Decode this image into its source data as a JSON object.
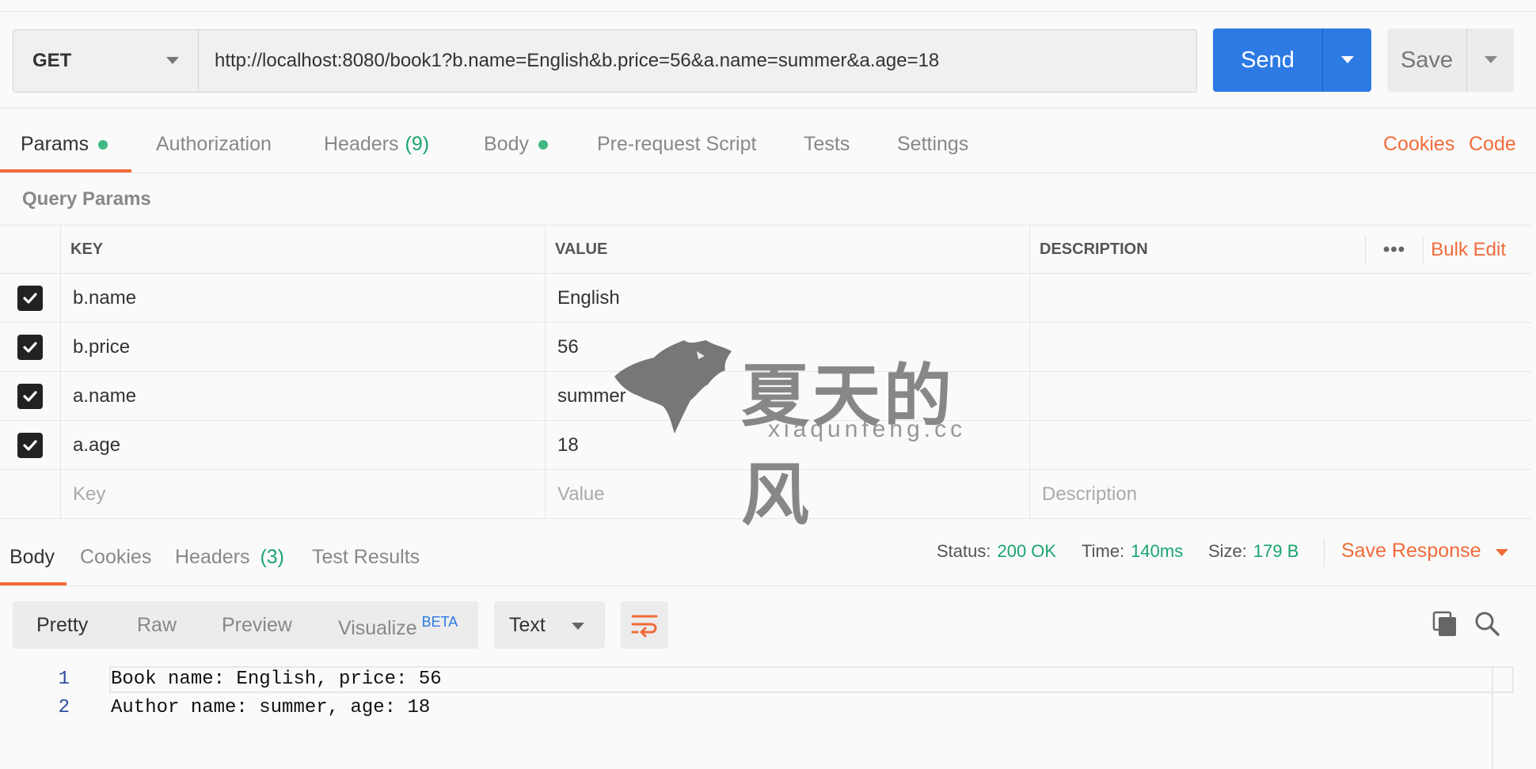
{
  "request": {
    "method": "GET",
    "url": "http://localhost:8080/book1?b.name=English&b.price=56&a.name=summer&a.age=18",
    "send_label": "Send",
    "save_label": "Save"
  },
  "request_tabs": {
    "params": "Params",
    "authorization": "Authorization",
    "headers": "Headers",
    "headers_count": "(9)",
    "body": "Body",
    "prerequest": "Pre-request Script",
    "tests": "Tests",
    "settings": "Settings",
    "cookies": "Cookies",
    "code": "Code"
  },
  "query_params": {
    "title": "Query Params",
    "columns": {
      "key": "KEY",
      "value": "VALUE",
      "description": "DESCRIPTION"
    },
    "more": "•••",
    "bulk_edit": "Bulk Edit",
    "rows": [
      {
        "key": "b.name",
        "value": "English",
        "checked": true
      },
      {
        "key": "b.price",
        "value": "56",
        "checked": true
      },
      {
        "key": "a.name",
        "value": "summer",
        "checked": true
      },
      {
        "key": "a.age",
        "value": "18",
        "checked": true
      }
    ],
    "placeholders": {
      "key": "Key",
      "value": "Value",
      "description": "Description"
    }
  },
  "response_tabs": {
    "body": "Body",
    "cookies": "Cookies",
    "headers": "Headers",
    "headers_count": "(3)",
    "test_results": "Test Results"
  },
  "response_meta": {
    "status_label": "Status:",
    "status_value": "200 OK",
    "time_label": "Time:",
    "time_value": "140ms",
    "size_label": "Size:",
    "size_value": "179 B",
    "save_response": "Save Response"
  },
  "view_modes": {
    "pretty": "Pretty",
    "raw": "Raw",
    "preview": "Preview",
    "visualize": "Visualize",
    "beta": "BETA",
    "format": "Text"
  },
  "response_body": {
    "lines": [
      {
        "number": "1",
        "text": "Book name: English, price: 56"
      },
      {
        "number": "2",
        "text": "Author name: summer, age: 18"
      }
    ]
  },
  "watermark": {
    "title": "夏天的风",
    "site": "xiaqunfeng.cc"
  },
  "colors": {
    "accent": "#f26b3a",
    "send": "#2d7ae5",
    "status_ok": "#1aa46e",
    "dot": "#41b883"
  }
}
